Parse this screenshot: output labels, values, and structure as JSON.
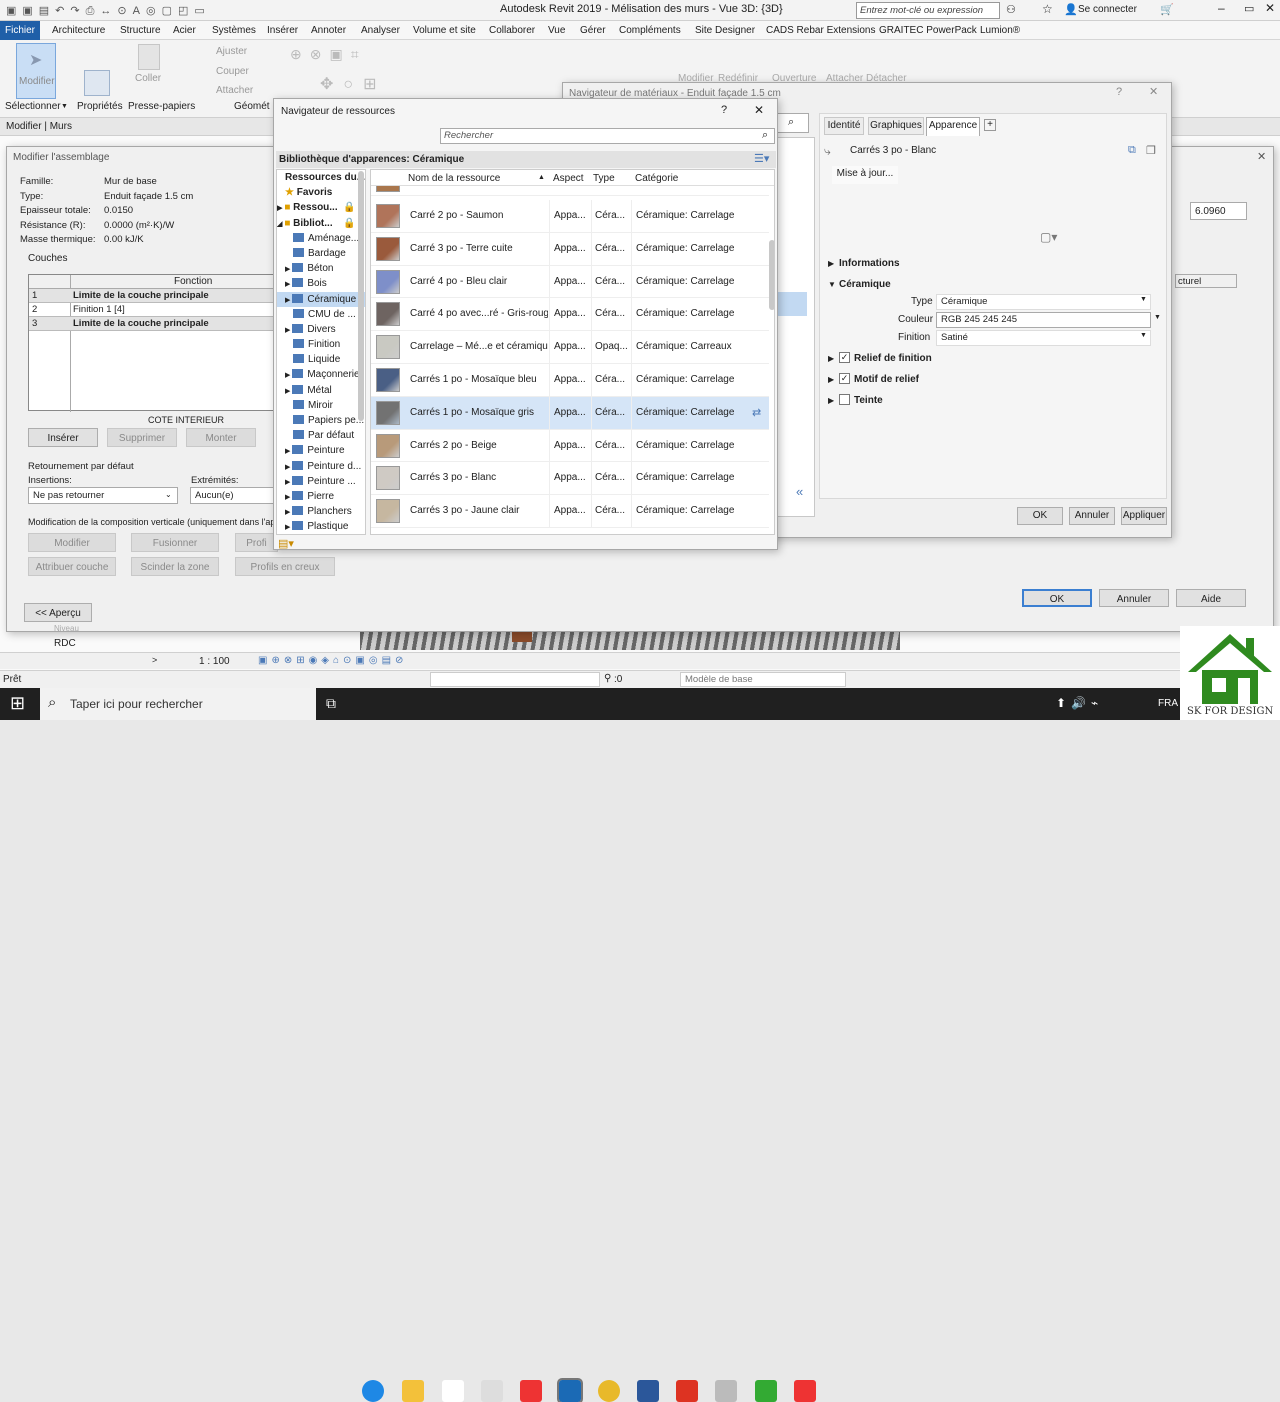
{
  "title": "Autodesk Revit 2019 - Mélisation des murs - Vue 3D: {3D}",
  "search_placeholder": "Entrez mot-clé ou expression",
  "sign_in": "Se connecter",
  "menu": [
    "Fichier",
    "Architecture",
    "Structure",
    "Acier",
    "Systèmes",
    "Insérer",
    "Annoter",
    "Analyser",
    "Volume et site",
    "Collaborer",
    "Vue",
    "Gérer",
    "Compléments",
    "Site Designer",
    "CADS Rebar Extensions",
    "GRAITEC PowerPack",
    "Lumion®"
  ],
  "ribbon": {
    "modifier": "Modifier",
    "coller": "Coller",
    "ajuster": "Ajuster",
    "couper": "Couper",
    "attacher": "Attacher",
    "modifier2": "Modifier",
    "redefinir": "Redéfinir",
    "ouverture": "Ouverture",
    "attacher2": "Attacher",
    "detacher": "Détacher",
    "selectionner": "Sélectionner",
    "proprietes": "Propriétés",
    "presse_papiers": "Presse-papiers",
    "geometrie": "Géomét"
  },
  "context_label": "Modifier | Murs",
  "assembly": {
    "title": "Modifier l'assemblage",
    "props": [
      {
        "k": "Famille:",
        "v": "Mur de base"
      },
      {
        "k": "Type:",
        "v": "Enduit façade 1.5 cm"
      },
      {
        "k": "Epaisseur totale:",
        "v": "0.0150"
      },
      {
        "k": "Résistance (R):",
        "v": "0.0000 (m²·K)/W"
      },
      {
        "k": "Masse thermique:",
        "v": "0.00 kJ/K"
      }
    ],
    "couches": "Couches",
    "col_fonction": "Fonction",
    "rows": [
      {
        "n": "1",
        "f": "Limite de la couche principale"
      },
      {
        "n": "2",
        "f": "Finition 1 [4]"
      },
      {
        "n": "3",
        "f": "Limite de la couche principale"
      }
    ],
    "cote": "COTE INTERIEUR",
    "inserer": "Insérer",
    "supprimer": "Supprimer",
    "monter": "Monter",
    "retournement": "Retournement par défaut",
    "insertions": "Insertions:",
    "insertions_val": "Ne pas retourner",
    "extremites": "Extrémités:",
    "extremites_val": "Aucun(e)",
    "modif_comp": "Modification de la composition verticale (uniquement dans l'aperçu",
    "modifier": "Modifier",
    "fusionner": "Fusionner",
    "profil": "Profi",
    "attribuer": "Attribuer couche",
    "scinder": "Scinder la zone",
    "profils": "Profils en creux",
    "apercu": "<< Aperçu",
    "ok": "OK",
    "annuler": "Annuler",
    "aide": "Aide",
    "value_right": "6.0960",
    "col_right": "cturel"
  },
  "materials": {
    "title": "Navigateur de matériaux - Enduit façade 1.5 cm",
    "tabs": [
      "Identité",
      "Graphiques",
      "Apparence"
    ],
    "asset_name": "Carrés 3 po - Blanc",
    "update": "Mise à jour...",
    "informations": "Informations",
    "ceramique": "Céramique",
    "type_label": "Type",
    "type_val": "Céramique",
    "couleur_label": "Couleur",
    "couleur_val": "RGB 245 245 245",
    "finition_label": "Finition",
    "finition_val": "Satiné",
    "relief_finition": "Relief de finition",
    "motif_relief": "Motif de relief",
    "teinte": "Teinte",
    "ok": "OK",
    "annuler": "Annuler",
    "appliquer": "Appliquer"
  },
  "resources": {
    "title": "Navigateur de ressources",
    "search_placeholder": "Rechercher",
    "library_title": "Bibliothèque d'apparences: Céramique",
    "tree": [
      {
        "label": "Ressources du...",
        "level": 0
      },
      {
        "label": "Favoris",
        "level": 1
      },
      {
        "label": "Ressou...",
        "level": 1
      },
      {
        "label": "Bibliot...",
        "level": 1
      },
      {
        "label": "Aménage...",
        "level": 2
      },
      {
        "label": "Bardage",
        "level": 2
      },
      {
        "label": "Béton",
        "level": 2
      },
      {
        "label": "Bois",
        "level": 2
      },
      {
        "label": "Céramique",
        "level": 2,
        "selected": true
      },
      {
        "label": "CMU de ...",
        "level": 2
      },
      {
        "label": "Divers",
        "level": 2
      },
      {
        "label": "Finition",
        "level": 2
      },
      {
        "label": "Liquide",
        "level": 2
      },
      {
        "label": "Maçonnerie",
        "level": 2
      },
      {
        "label": "Métal",
        "level": 2
      },
      {
        "label": "Miroir",
        "level": 2
      },
      {
        "label": "Papiers pe...",
        "level": 2
      },
      {
        "label": "Par défaut",
        "level": 2
      },
      {
        "label": "Peinture",
        "level": 2
      },
      {
        "label": "Peinture d...",
        "level": 2
      },
      {
        "label": "Peinture ...",
        "level": 2
      },
      {
        "label": "Pierre",
        "level": 2
      },
      {
        "label": "Planchers",
        "level": 2
      },
      {
        "label": "Plastique",
        "level": 2
      }
    ],
    "columns": [
      "Nom de la ressource",
      "Aspect",
      "Type",
      "Catégorie"
    ],
    "rows": [
      {
        "name": "Carré 2 po - Saumon",
        "aspect": "Appa...",
        "type": "Céra...",
        "cat": "Céramique: Carrelage",
        "color": "#b0745a"
      },
      {
        "name": "Carré 3 po - Terre cuite",
        "aspect": "Appa...",
        "type": "Céra...",
        "cat": "Céramique: Carrelage",
        "color": "#9a5a3c"
      },
      {
        "name": "Carré 4 po - Bleu clair",
        "aspect": "Appa...",
        "type": "Céra...",
        "cat": "Céramique: Carrelage",
        "color": "#7e8fc9"
      },
      {
        "name": "Carré 4 po avec...ré - Gris-rouge",
        "aspect": "Appa...",
        "type": "Céra...",
        "cat": "Céramique: Carrelage",
        "color": "#6e6461"
      },
      {
        "name": "Carrelage – Mé...e et céramique",
        "aspect": "Appa...",
        "type": "Opaq...",
        "cat": "Céramique: Carreaux",
        "color": "#c9c9c2"
      },
      {
        "name": "Carrés 1 po - Mosaïque bleu",
        "aspect": "Appa...",
        "type": "Céra...",
        "cat": "Céramique: Carrelage",
        "color": "#4a5f85"
      },
      {
        "name": "Carrés 1 po - Mosaïque gris",
        "aspect": "Appa...",
        "type": "Céra...",
        "cat": "Céramique: Carrelage",
        "color": "#727272",
        "selected": true
      },
      {
        "name": "Carrés 2 po - Beige",
        "aspect": "Appa...",
        "type": "Céra...",
        "cat": "Céramique: Carrelage",
        "color": "#b89a7a"
      },
      {
        "name": "Carrés 3 po - Blanc",
        "aspect": "Appa...",
        "type": "Céra...",
        "cat": "Céramique: Carrelage",
        "color": "#cfcac4"
      },
      {
        "name": "Carrés 3 po - Jaune clair",
        "aspect": "Appa...",
        "type": "Céra...",
        "cat": "Céramique: Carrelage",
        "color": "#c6b7a0"
      }
    ]
  },
  "view": {
    "scale": "1 : 100",
    "level1": "Niveau",
    "level2": "RDC"
  },
  "status": {
    "ready": "Prêt",
    "zero": ":0",
    "model": "Modèle de base"
  },
  "taskbar": {
    "search": "Taper ici pour rechercher",
    "lang": "FRA"
  },
  "watermark": "SK FOR DESIGN"
}
